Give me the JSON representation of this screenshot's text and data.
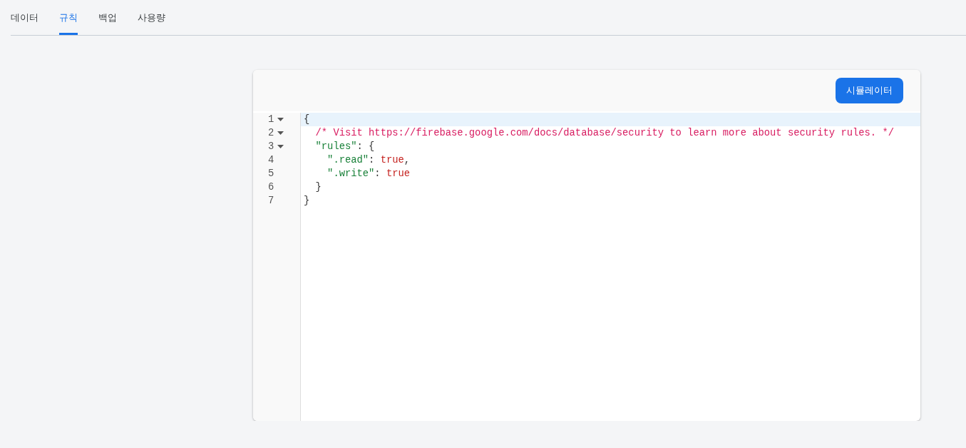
{
  "tabs": [
    {
      "label": "데이터",
      "selected": false
    },
    {
      "label": "규칙",
      "selected": true
    },
    {
      "label": "백업",
      "selected": false
    },
    {
      "label": "사용량",
      "selected": false
    }
  ],
  "toolbar": {
    "button": "시뮬레이터"
  },
  "editor": {
    "lines": [
      {
        "number": "1",
        "foldable": true,
        "active": true,
        "tokens": [
          {
            "kind": "punct",
            "text": "{"
          }
        ]
      },
      {
        "number": "2",
        "foldable": true,
        "active": false,
        "tokens": [
          {
            "kind": "comment",
            "text": "  /* Visit https://firebase.google.com/docs/database/security to learn more about security rules. */"
          }
        ]
      },
      {
        "number": "3",
        "foldable": true,
        "active": false,
        "tokens": [
          {
            "kind": "key",
            "text": "  \"rules\""
          },
          {
            "kind": "punct",
            "text": ": {"
          }
        ]
      },
      {
        "number": "4",
        "foldable": false,
        "active": false,
        "tokens": [
          {
            "kind": "key",
            "text": "    \".read\""
          },
          {
            "kind": "punct",
            "text": ": "
          },
          {
            "kind": "bool",
            "text": "true"
          },
          {
            "kind": "punct",
            "text": ","
          }
        ]
      },
      {
        "number": "5",
        "foldable": false,
        "active": false,
        "tokens": [
          {
            "kind": "key",
            "text": "    \".write\""
          },
          {
            "kind": "punct",
            "text": ": "
          },
          {
            "kind": "bool",
            "text": "true"
          }
        ]
      },
      {
        "number": "6",
        "foldable": false,
        "active": false,
        "tokens": [
          {
            "kind": "punct",
            "text": "  }"
          }
        ]
      },
      {
        "number": "7",
        "foldable": false,
        "active": false,
        "tokens": [
          {
            "kind": "punct",
            "text": "}"
          }
        ]
      }
    ]
  }
}
